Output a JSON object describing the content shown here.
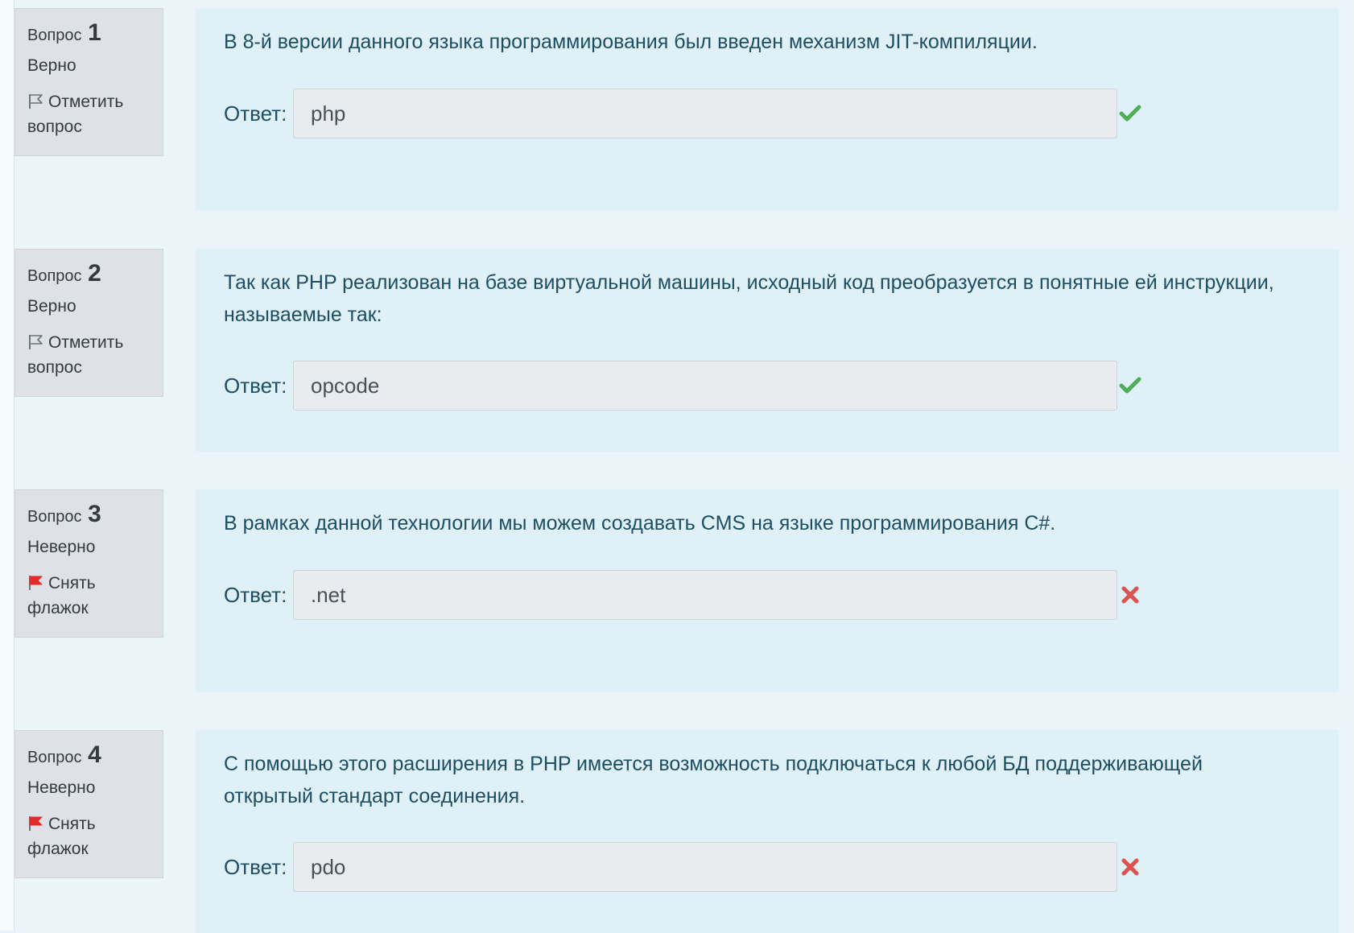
{
  "questions": [
    {
      "label": "Вопрос",
      "number": "1",
      "state": "Верно",
      "flag_label": "Отметить вопрос",
      "flagged": false,
      "text": "В 8-й версии данного языка программирования был введен механизм JIT-компиляции.",
      "answer_label": "Ответ:",
      "answer_value": "php",
      "result_icon": "check-icon",
      "result_color": "#4ead57"
    },
    {
      "label": "Вопрос",
      "number": "2",
      "state": "Верно",
      "flag_label": "Отметить вопрос",
      "flagged": false,
      "text": "Так как PHP реализован на базе виртуальной машины, исходный код преобразуется в понятные ей инструкции, называемые так:",
      "answer_label": "Ответ:",
      "answer_value": "opcode",
      "result_icon": "check-icon",
      "result_color": "#4ead57"
    },
    {
      "label": "Вопрос",
      "number": "3",
      "state": "Неверно",
      "flag_label": "Снять флажок",
      "flagged": true,
      "text": "В рамках данной технологии мы можем создавать CMS на языке программирования C#.",
      "answer_label": "Ответ:",
      "answer_value": ".net",
      "result_icon": "cross-icon",
      "result_color": "#d9534f"
    },
    {
      "label": "Вопрос",
      "number": "4",
      "state": "Неверно",
      "flag_label": "Снять флажок",
      "flagged": true,
      "text": "С помощью этого расширения в PHP имеется возможность подключаться к любой БД поддерживающей открытый стандарт соединения.",
      "answer_label": "Ответ:",
      "answer_value": "pdo",
      "result_icon": "cross-icon",
      "result_color": "#d9534f"
    }
  ]
}
